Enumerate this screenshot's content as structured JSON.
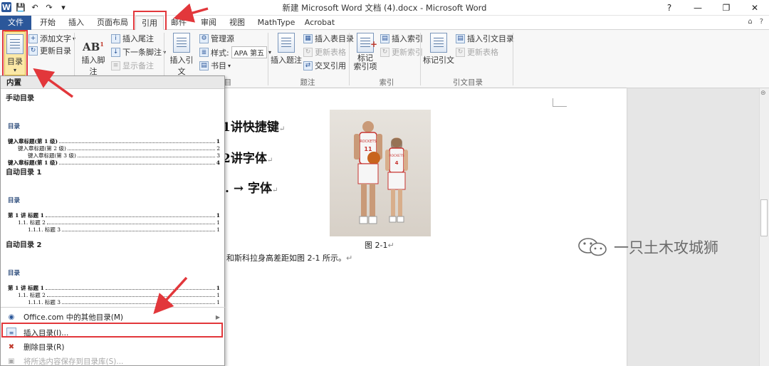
{
  "window": {
    "title": "新建 Microsoft Word 文档 (4).docx - Microsoft Word",
    "minimize": "—",
    "maximize": "❐",
    "close": "✕",
    "help": "?",
    "collapse": "⌂"
  },
  "qat": {
    "app_icon": "W",
    "save": "💾",
    "undo": "↶",
    "redo": "↷",
    "more": "▾"
  },
  "tabs": [
    "文件",
    "开始",
    "插入",
    "页面布局",
    "引用",
    "邮件",
    "审阅",
    "视图",
    "MathType",
    "Acrobat"
  ],
  "active_tab": "引用",
  "ribbon": {
    "toc_button": "目录",
    "add_text": "添加文字",
    "update_toc": "更新目录",
    "insert_footnote": "插入脚注",
    "insert_endnote": "插入尾注",
    "next_footnote": "下一条脚注",
    "show_notes": "显示备注",
    "insert_citation": "插入引文",
    "manage_sources": "管理源",
    "style_label": "样式:",
    "style_value": "APA 第五",
    "bibliography": "书目",
    "citations_group": "目",
    "insert_caption": "插入题注",
    "insert_table_of_figures": "插入表目录",
    "update_table": "更新表格",
    "cross_reference": "交叉引用",
    "captions_group": "题注",
    "mark_entry": "标记\n索引项",
    "insert_index": "插入索引",
    "update_index": "更新索引",
    "index_group": "索引",
    "mark_citation": "标记引文",
    "insert_toa": "插入引文目录",
    "update_toa": "更新表格",
    "toa_group": "引文目录"
  },
  "dropdown": {
    "builtin_header": "内置",
    "manual_toc": "手动目录",
    "manual_preview": {
      "title": "目录",
      "lines": [
        {
          "text": "键入章标题(第 1 级)",
          "page": "1",
          "indent": 0,
          "bold": true
        },
        {
          "text": "键入章标题(第 2 级)",
          "page": "2",
          "indent": 1,
          "bold": false
        },
        {
          "text": "键入章标题(第 3 级)",
          "page": "3",
          "indent": 2,
          "bold": false
        },
        {
          "text": "键入章标题(第 1 级)",
          "page": "4",
          "indent": 0,
          "bold": true
        }
      ]
    },
    "auto_toc_1": "自动目录 1",
    "auto1_preview": {
      "title": "目录",
      "lines": [
        {
          "text": "第 1 讲      标题 1",
          "page": "1",
          "indent": 0,
          "bold": true
        },
        {
          "text": "1.1.      标题 2",
          "page": "1",
          "indent": 1,
          "bold": false
        },
        {
          "text": "1.1.1.    标题 3",
          "page": "1",
          "indent": 2,
          "bold": false
        }
      ]
    },
    "auto_toc_2": "自动目录 2",
    "auto2_preview": {
      "title": "目录",
      "lines": [
        {
          "text": "第 1 讲      标题 1",
          "page": "1",
          "indent": 0,
          "bold": true
        },
        {
          "text": "1.1.      标题 2",
          "page": "1",
          "indent": 1,
          "bold": false
        },
        {
          "text": "1.1.1.    标题 3",
          "page": "1",
          "indent": 2,
          "bold": false
        }
      ]
    },
    "more_from_office": "Office.com 中的其他目录(M)",
    "insert_toc": "插入目录(I)...",
    "remove_toc": "删除目录(R)",
    "save_selection": "将所选内容保存到目录库(S)..."
  },
  "document": {
    "heading1": "1讲快捷键",
    "heading2": "2讲字体",
    "heading3": ". → 字体",
    "caption": "图 2-1",
    "body_text": "和斯科拉身高差距如图 2-1 所示。",
    "para_mark": "↵",
    "jersey1": "11",
    "jersey2": "4",
    "team": "ROCKETS"
  },
  "watermark": "一只土木攻城狮",
  "colors": {
    "accent": "#2b579a",
    "highlight": "#e2373b"
  }
}
